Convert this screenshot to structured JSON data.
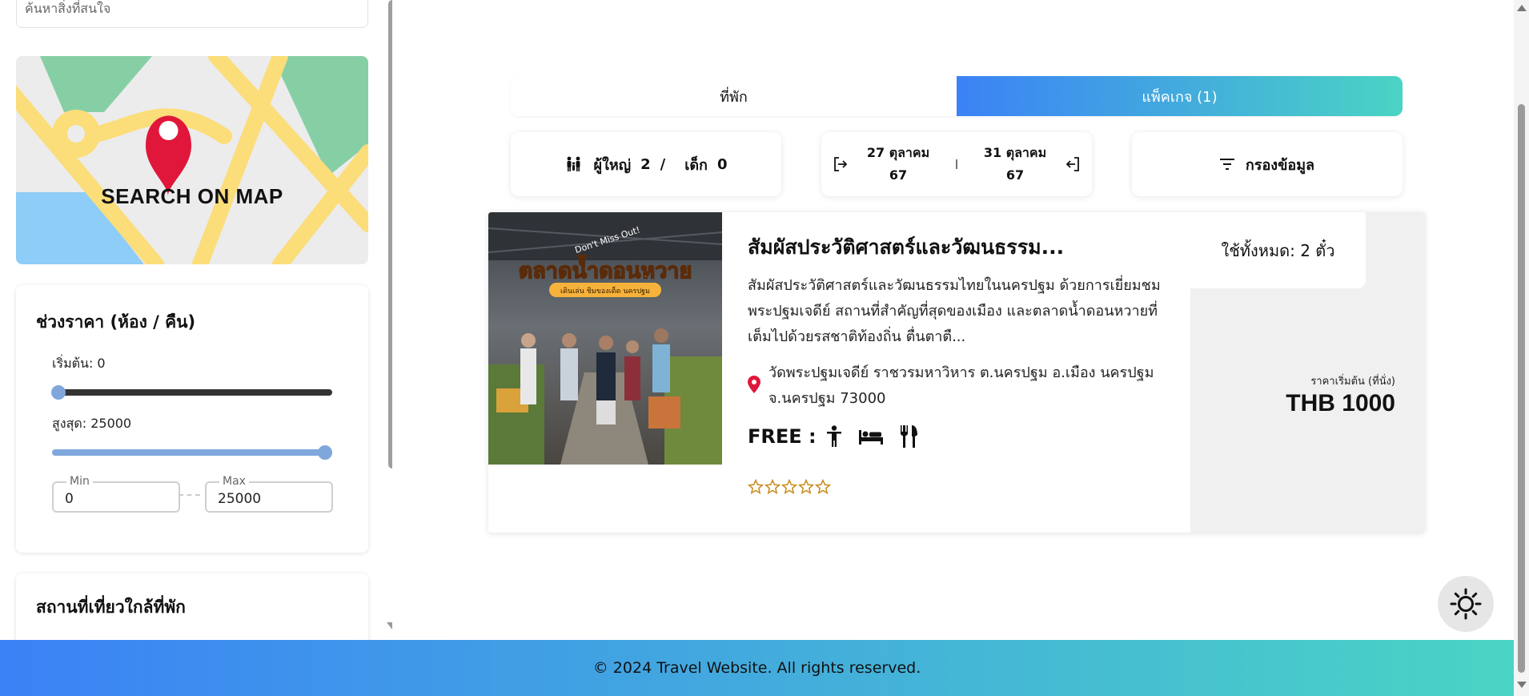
{
  "sidebar": {
    "search_placeholder": "ค้นหาสิ่งที่สนใจ",
    "map_button_label": "SEARCH ON MAP",
    "price_filter": {
      "title": "ช่วงราคา (ห้อง / คืน)",
      "min_label": "เริ่มต้น: 0",
      "max_label": "สูงสุด: 25000",
      "min_legend": "Min",
      "min_value": "0",
      "max_legend": "Max",
      "max_value": "25000"
    },
    "nearby_title": "สถานที่เที่ยวใกล้ที่พัก"
  },
  "tabs": {
    "stay_label": "ที่พัก",
    "package_label": "แพ็คเกจ (1)"
  },
  "filters": {
    "guests": {
      "adult_label": "ผู้ใหญ่",
      "adult_count": "2",
      "separator": "/",
      "child_label": "เด็ก",
      "child_count": "0"
    },
    "dates": {
      "checkin_line1": "27 ตุลาคม",
      "checkin_line2": "67",
      "checkout_line1": "31 ตุลาคม",
      "checkout_line2": "67"
    },
    "filter_label": "กรองข้อมูล"
  },
  "package": {
    "image": {
      "top_badge": "Don't Miss Out!",
      "headline": "ตลาดน้ำดอนหวาย",
      "subline": "เดินเล่น ชิมของเด็ด นครปฐม"
    },
    "title": "สัมผัสประวัติศาสตร์และวัฒนธรรม...",
    "description": "สัมผัสประวัติศาสตร์และวัฒนธรรมไทยในนครปฐม ด้วยการเยี่ยมชมพระปฐมเจดีย์ สถานที่สำคัญที่สุดของเมือง และตลาดน้ำดอนหวายที่เต็มไปด้วยรสชาติท้องถิ่น ตื่นตาตื...",
    "address": "วัดพระปฐมเจดีย์ ราชวรมหาวิหาร ต.นครปฐม อ.เมือง นครปฐม จ.นครปฐม 73000",
    "free_label": "FREE :",
    "free_icons": [
      "person-icon",
      "bed-icon",
      "utensils-icon"
    ],
    "rating": 0,
    "rating_max": 5,
    "quota": "ใช้ทั้งหมด: 2 ตั๋ว",
    "price_caption": "ราคาเริ่มต้น (ที่นั่ง)",
    "price": "THB 1000"
  },
  "footer": {
    "text": "© 2024 Travel Website. All rights reserved."
  },
  "colors": {
    "accent_start": "#3b82f6",
    "accent_end": "#4ad4c4",
    "slider_dark": "#333333",
    "slider_blue": "#7fa7dc",
    "pin_red": "#e0173a",
    "star_gold": "#c88a1a"
  }
}
